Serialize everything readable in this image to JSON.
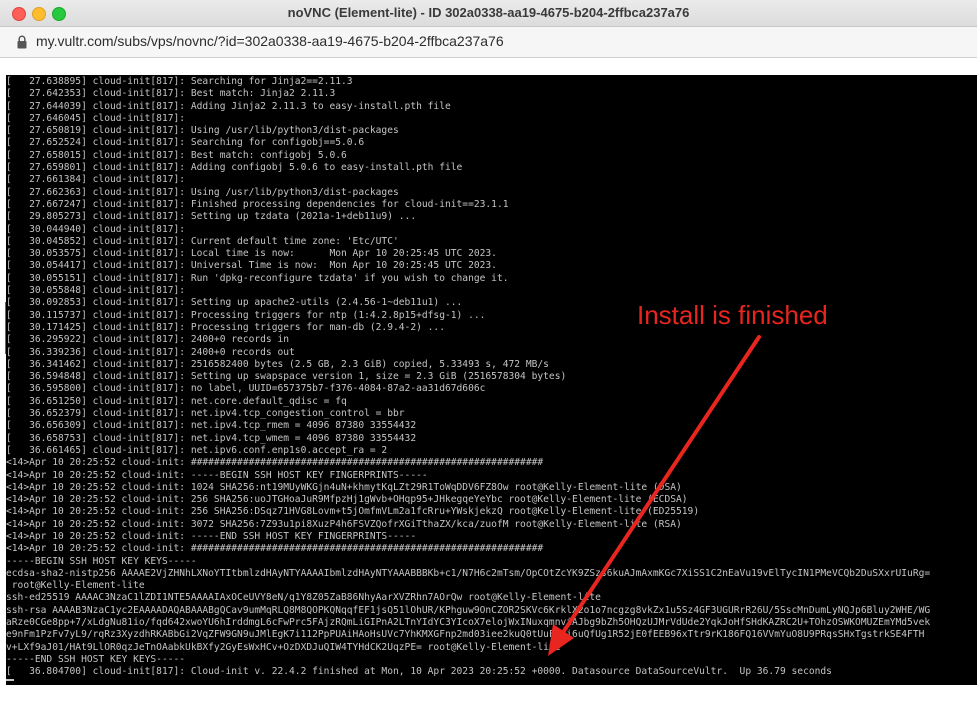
{
  "window": {
    "title": "noVNC (Element-lite) - ID 302a0338-aa19-4675-b204-2ffbca237a76",
    "url": "my.vultr.com/subs/vps/novnc/?id=302a0338-aa19-4675-b204-2ffbca237a76"
  },
  "icons": {
    "lock": "lock-icon",
    "side_handle": "chevron-right-icon"
  },
  "colors": {
    "annotation": "#e8251e",
    "terminal_bg": "#000000",
    "terminal_text": "#c4c4c4"
  },
  "annotation": {
    "label": "Install is finished"
  },
  "terminal": {
    "lines": [
      "[   27.638895] cloud-init[817]: Searching for Jinja2==2.11.3",
      "[   27.642353] cloud-init[817]: Best match: Jinja2 2.11.3",
      "[   27.644039] cloud-init[817]: Adding Jinja2 2.11.3 to easy-install.pth file",
      "[   27.646045] cloud-init[817]:",
      "[   27.650819] cloud-init[817]: Using /usr/lib/python3/dist-packages",
      "[   27.652524] cloud-init[817]: Searching for configobj==5.0.6",
      "[   27.658015] cloud-init[817]: Best match: configobj 5.0.6",
      "[   27.659801] cloud-init[817]: Adding configobj 5.0.6 to easy-install.pth file",
      "[   27.661384] cloud-init[817]:",
      "[   27.662363] cloud-init[817]: Using /usr/lib/python3/dist-packages",
      "[   27.667247] cloud-init[817]: Finished processing dependencies for cloud-init==23.1.1",
      "[   29.805273] cloud-init[817]: Setting up tzdata (2021a-1+deb11u9) ...",
      "[   30.044940] cloud-init[817]:",
      "[   30.045852] cloud-init[817]: Current default time zone: 'Etc/UTC'",
      "[   30.053575] cloud-init[817]: Local time is now:      Mon Apr 10 20:25:45 UTC 2023.",
      "[   30.054417] cloud-init[817]: Universal Time is now:  Mon Apr 10 20:25:45 UTC 2023.",
      "[   30.055151] cloud-init[817]: Run 'dpkg-reconfigure tzdata' if you wish to change it.",
      "[   30.055848] cloud-init[817]:",
      "[   30.092853] cloud-init[817]: Setting up apache2-utils (2.4.56-1~deb11u1) ...",
      "[   30.115737] cloud-init[817]: Processing triggers for ntp (1:4.2.8p15+dfsg-1) ...",
      "[   30.171425] cloud-init[817]: Processing triggers for man-db (2.9.4-2) ...",
      "[   36.295922] cloud-init[817]: 2400+0 records in",
      "[   36.339236] cloud-init[817]: 2400+0 records out",
      "[   36.341462] cloud-init[817]: 2516582400 bytes (2.5 GB, 2.3 GiB) copied, 5.33493 s, 472 MB/s",
      "[   36.594848] cloud-init[817]: Setting up swapspace version 1, size = 2.3 GiB (2516578304 bytes)",
      "[   36.595800] cloud-init[817]: no label, UUID=657375b7-f376-4084-87a2-aa31d67d606c",
      "[   36.651250] cloud-init[817]: net.core.default_qdisc = fq",
      "[   36.652379] cloud-init[817]: net.ipv4.tcp_congestion_control = bbr",
      "[   36.656309] cloud-init[817]: net.ipv4.tcp_rmem = 4096 87380 33554432",
      "[   36.658753] cloud-init[817]: net.ipv4.tcp_wmem = 4096 87380 33554432",
      "[   36.661465] cloud-init[817]: net.ipv6.conf.enp1s0.accept_ra = 2",
      "<14>Apr 10 20:25:52 cloud-init: #############################################################",
      "<14>Apr 10 20:25:52 cloud-init: -----BEGIN SSH HOST KEY FINGERPRINTS-----",
      "<14>Apr 10 20:25:52 cloud-init: 1024 SHA256:nt19MUyWKGjn4uN+khmytKqLZt29R1ToWqDDV6FZ8Ow root@Kelly-Element-lite (DSA)",
      "<14>Apr 10 20:25:52 cloud-init: 256 SHA256:uoJTGHoaJuR9MfpzHj1gWvb+OHqp95+JHkegqeYeYbc root@Kelly-Element-lite (ECDSA)",
      "<14>Apr 10 20:25:52 cloud-init: 256 SHA256:DSqz71HVG8Lovm+t5jOmfmVLm2a1fcRru+YWskjekzQ root@Kelly-Element-lite (ED25519)",
      "<14>Apr 10 20:25:52 cloud-init: 3072 SHA256:7Z93u1pi8XuzP4h6FSVZQofrXGiTthaZX/kca/zuofM root@Kelly-Element-lite (RSA)",
      "<14>Apr 10 20:25:52 cloud-init: -----END SSH HOST KEY FINGERPRINTS-----",
      "<14>Apr 10 20:25:52 cloud-init: #############################################################",
      "-----BEGIN SSH HOST KEY KEYS-----",
      "ecdsa-sha2-nistp256 AAAAE2VjZHNhLXNoYTItbmlzdHAyNTYAAAAIbmlzdHAyNTYAAABBBKb+c1/N7H6c2mTsm/OpCOtZcYK9ZSzs6kuAJmAxmKGc7XiSS1C2nEaVu19vElTycIN1PMeVCQb2DuSXxrUIuRg=",
      " root@Kelly-Element-lite",
      "ssh-ed25519 AAAAC3NzaC1lZDI1NTE5AAAAIAxOCeUVY8eN/q1Y8Z05ZaB86NhyAarXVZRhn7AOrQw root@Kelly-Element-lite",
      "ssh-rsa AAAAB3NzaC1yc2EAAAADAQABAAABgQCav9umMqRLQ8M8QOPKQNqqfEF1jsQ51lOhUR/KPhguw9OnCZOR2SKVc6KrklX2o1o7ncgzg8vkZx1u5Sz4GF3UGURrR26U/5SscMnDumLyNQJp6Bluy2WHE/WG",
      "aRze0CGe8pp+7/xLdgNu81io/fqd642xwoYU6hIrddmgL6cFwPrc5FAjzRQmLiGIPnA2LTnYIdYC3YIcoX7elojWxINuxqmnviAJbg9bZh5OHQzUJMrVdUde2YqkJoHfSHdKAZRC2U+TOhzOSWKOMUZEmYMd5vek",
      "e9nFm1PzFv7yL9/rqRz3XyzdhRKABbGi2VqZFW9GN9uJMlEgK7i112PpPUAiHAoHsUVc7YhKMXGFnp2md03iee2kuQ0tUuFH6i6uQfUg1R52jE0fEEB96xTtr9rK186FQ16VVmYuO8U9PRqsSHxTgstrkSE4FTH",
      "v+LXf9aJ01/HAt9LlOR0qzJeTnOAabkUkBXfy2GyEsWxHCv+OzDXDJuQIW4TYHdCK2UqzPE= root@Kelly-Element-lite",
      "-----END SSH HOST KEY KEYS-----",
      "[   36.804700] cloud-init[817]: Cloud-init v. 22.4.2 finished at Mon, 10 Apr 2023 20:25:52 +0000. Datasource DataSourceVultr.  Up 36.79 seconds"
    ]
  }
}
